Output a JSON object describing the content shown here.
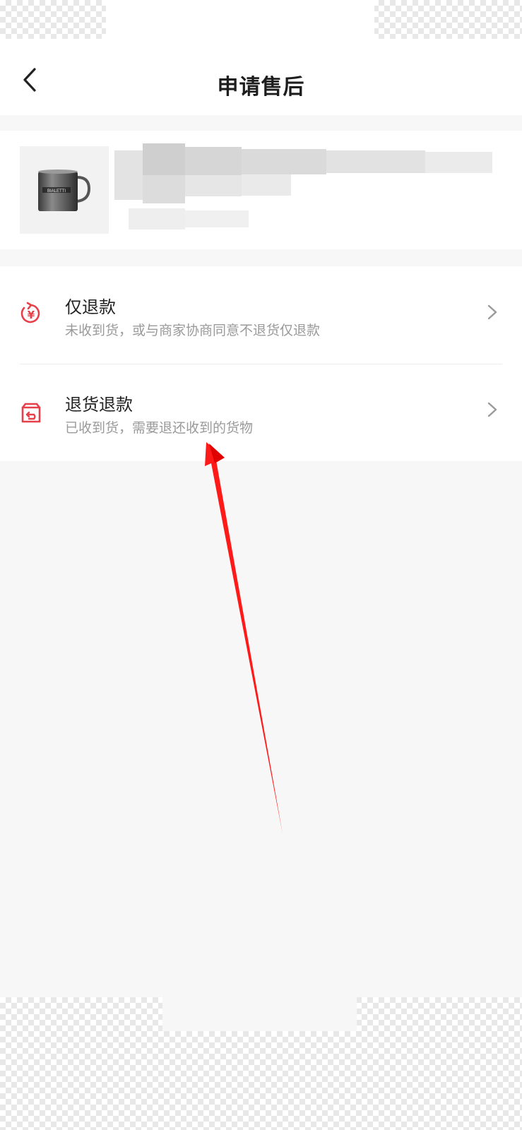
{
  "header": {
    "title": "申请售后",
    "back_icon": "chevron-left-icon"
  },
  "product": {
    "thumbnail": "product-thumbnail-mug",
    "thumb_brand": "BIALETTI"
  },
  "options": [
    {
      "icon": "refund-yen-icon",
      "title": "仅退款",
      "desc": "未收到货，或与商家协商同意不退货仅退款"
    },
    {
      "icon": "return-box-icon",
      "title": "退货退款",
      "desc": "已收到货，需要退还收到的货物"
    }
  ],
  "colors": {
    "accent": "#e8404a",
    "annotation_arrow": "#ff1a1a"
  }
}
